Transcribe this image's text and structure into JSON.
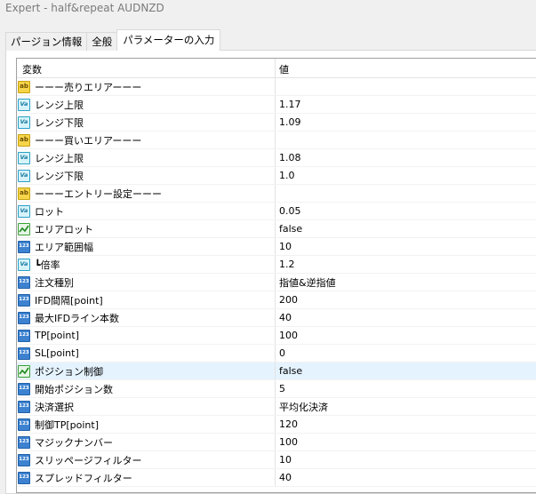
{
  "window": {
    "title": "Expert - half&repeat    AUDNZD"
  },
  "tabs": [
    {
      "label": "パージョン情報"
    },
    {
      "label": "全般"
    },
    {
      "label": "パラメーターの入力"
    }
  ],
  "grid": {
    "headers": {
      "variable": "変数",
      "value": "値"
    },
    "rows": [
      {
        "icon": "string-icon",
        "name": "ーーー売りエリアーーー",
        "value": ""
      },
      {
        "icon": "double-icon",
        "name": "レンジ上限",
        "value": "1.17"
      },
      {
        "icon": "double-icon",
        "name": "レンジ下限",
        "value": "1.09"
      },
      {
        "icon": "string-icon",
        "name": "ーーー買いエリアーーー",
        "value": ""
      },
      {
        "icon": "double-icon",
        "name": "レンジ上限",
        "value": "1.08"
      },
      {
        "icon": "double-icon",
        "name": "レンジ下限",
        "value": "1.0"
      },
      {
        "icon": "string-icon",
        "name": "ーーーエントリー設定ーーー",
        "value": ""
      },
      {
        "icon": "double-icon",
        "name": "ロット",
        "value": "0.05"
      },
      {
        "icon": "bool-icon",
        "name": "エリアロット",
        "value": "false"
      },
      {
        "icon": "integer-icon",
        "name": "エリア範囲幅",
        "value": "10"
      },
      {
        "icon": "double-icon",
        "name": "  ┗倍率",
        "value": "1.2"
      },
      {
        "icon": "integer-icon",
        "name": "注文種別",
        "value": "指値&逆指値"
      },
      {
        "icon": "integer-icon",
        "name": "IFD間隔[point]",
        "value": "200"
      },
      {
        "icon": "integer-icon",
        "name": "最大IFDライン本数",
        "value": "40"
      },
      {
        "icon": "integer-icon",
        "name": "TP[point]",
        "value": "100"
      },
      {
        "icon": "integer-icon",
        "name": "SL[point]",
        "value": "0"
      },
      {
        "icon": "bool-icon",
        "name": "ポジション制御",
        "value": "false",
        "selected": true
      },
      {
        "icon": "integer-icon",
        "name": "開始ポジション数",
        "value": "5"
      },
      {
        "icon": "integer-icon",
        "name": "決済選択",
        "value": "平均化決済"
      },
      {
        "icon": "integer-icon",
        "name": "制御TP[point]",
        "value": "120"
      },
      {
        "icon": "integer-icon",
        "name": "マジックナンバー",
        "value": "100"
      },
      {
        "icon": "integer-icon",
        "name": "スリッページフィルター",
        "value": "10"
      },
      {
        "icon": "integer-icon",
        "name": "スプレッドフィルター",
        "value": "40"
      }
    ]
  },
  "icon_glyphs": {
    "string-icon": "ab",
    "double-icon": "Va",
    "integer-icon": "123"
  }
}
